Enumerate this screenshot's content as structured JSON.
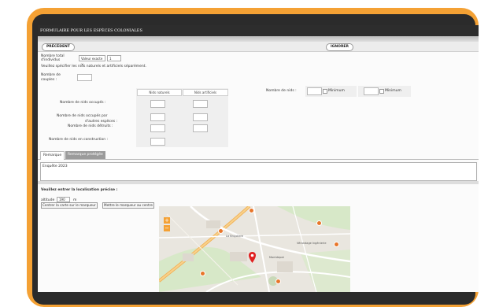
{
  "form": {
    "title": "FORMULAIRE POUR LES ESPÈCES COLONIALES",
    "prev_button": "PRÉCÉDENT",
    "ignore_button": "IGNORER",
    "total_label_1": "Nombre total",
    "total_label_2": "d'individus",
    "total_select": "Valeur exacte ∨",
    "total_value": "1",
    "instruction": "Veuillez spécifier les nids naturels et artificiels séparément.",
    "couples_label_1": "Nombre de",
    "couples_label_2": "couples :",
    "col_natural": "Nids naturels",
    "col_artificial": "Nids artificiels",
    "rows": [
      "Nombre de nids occupés :",
      "Nombre de nids occupés par",
      "d'autres espèces :",
      "Nombre de nids détruits :",
      "Nombre de nids en construction :"
    ],
    "nests_label": "Nombre de nids :",
    "minimum_label": "Minimum"
  },
  "tabs": [
    {
      "label": "Remarque"
    },
    {
      "label": "Remarque protégée"
    }
  ],
  "remarks_text": "Enquête 2023",
  "location": {
    "heading": "Veuillez entrer la localisation précise :",
    "altitude_label": "altitude",
    "altitude_value": "190",
    "altitude_unit": "m",
    "center_map_button": "Centrer la carte sur le marqueur",
    "center_marker_button": "Mettre le marqueur au centre"
  },
  "map": {
    "labels": [
      "La Brujoliere",
      "Montdepot",
      "Vérandage Ingénierie"
    ],
    "zoom_in": "+",
    "zoom_out": "−"
  },
  "colors": {
    "device_frame": "#f4a134",
    "title_bar": "#2d2d2d",
    "marker": "#e02020"
  }
}
